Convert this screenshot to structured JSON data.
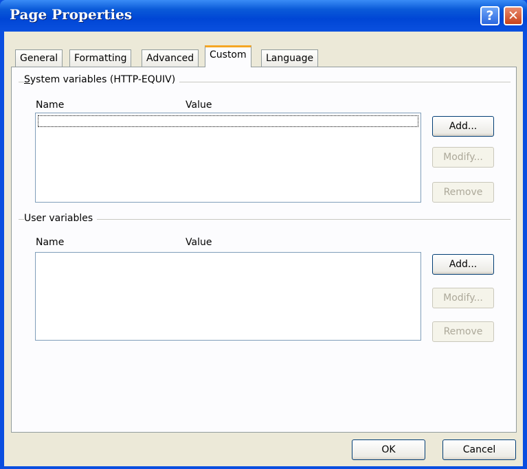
{
  "window": {
    "title": "Page Properties",
    "help_glyph": "?",
    "close_glyph": "✕"
  },
  "tabs": [
    {
      "label": "General"
    },
    {
      "label": "Formatting"
    },
    {
      "label": "Advanced"
    },
    {
      "label": "Custom",
      "active": true
    },
    {
      "label": "Language"
    }
  ],
  "system_variables": {
    "group_label": "System variables (HTTP-EQUIV)",
    "columns": [
      "Name",
      "Value"
    ],
    "add_label": "Add...",
    "modify_label": "Modify...",
    "remove_label": "Remove"
  },
  "user_variables": {
    "group_label": "User variables",
    "columns": [
      "Name",
      "Value"
    ],
    "add_label": "Add...",
    "modify_label": "Modify...",
    "remove_label": "Remove"
  },
  "footer": {
    "ok_label": "OK",
    "cancel_label": "Cancel"
  },
  "colors": {
    "title_bar": "#0a50df",
    "dialog_bg": "#ece9d8",
    "active_tab_accent": "#f5a623"
  }
}
